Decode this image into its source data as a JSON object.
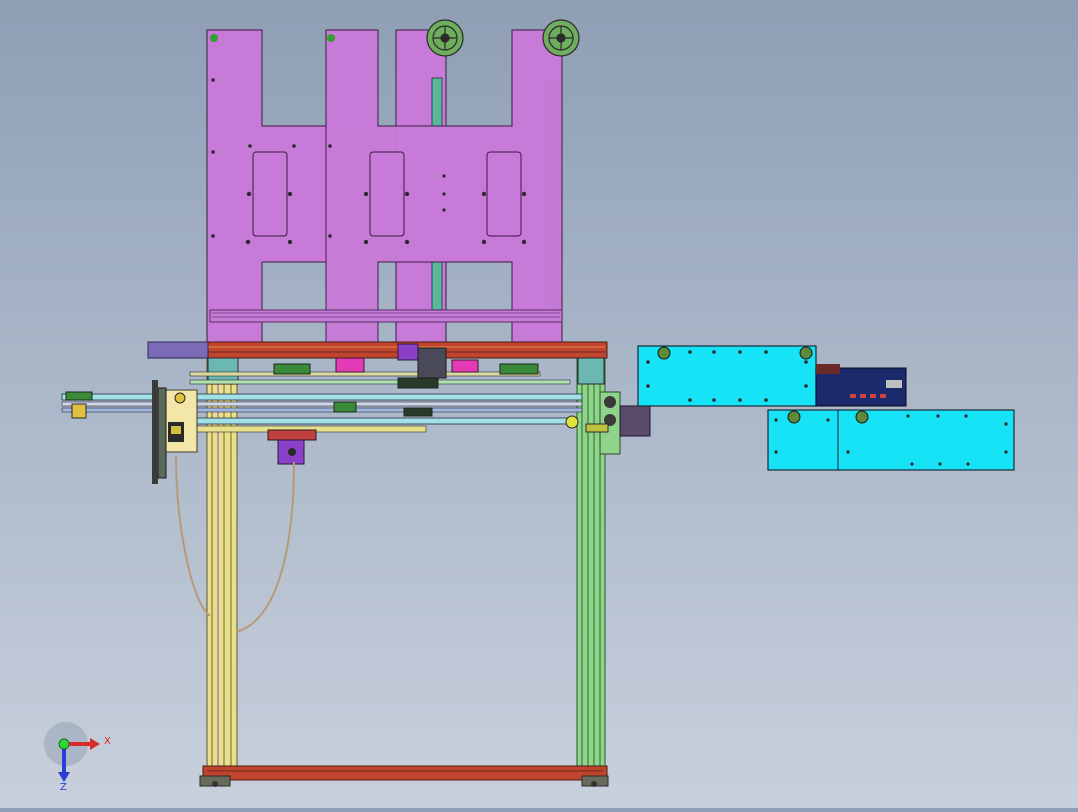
{
  "viewport": {
    "background_top": "#8f9eb4",
    "background_bottom": "#c8d0dc"
  },
  "colors": {
    "plate": "#c87ad8",
    "frame_green": "#8fd48a",
    "frame_yellow": "#e8e08a",
    "rail_red": "#c0442e",
    "box_cyan": "#17e3f7",
    "board_navy": "#1a2a6a",
    "motor_purple": "#8a40c8",
    "cable_tan": "#b89a78",
    "pink_block": "#e43ab8"
  },
  "triad": {
    "x_label": "X",
    "z_label": "Z",
    "icon": "axis-triad-icon"
  }
}
